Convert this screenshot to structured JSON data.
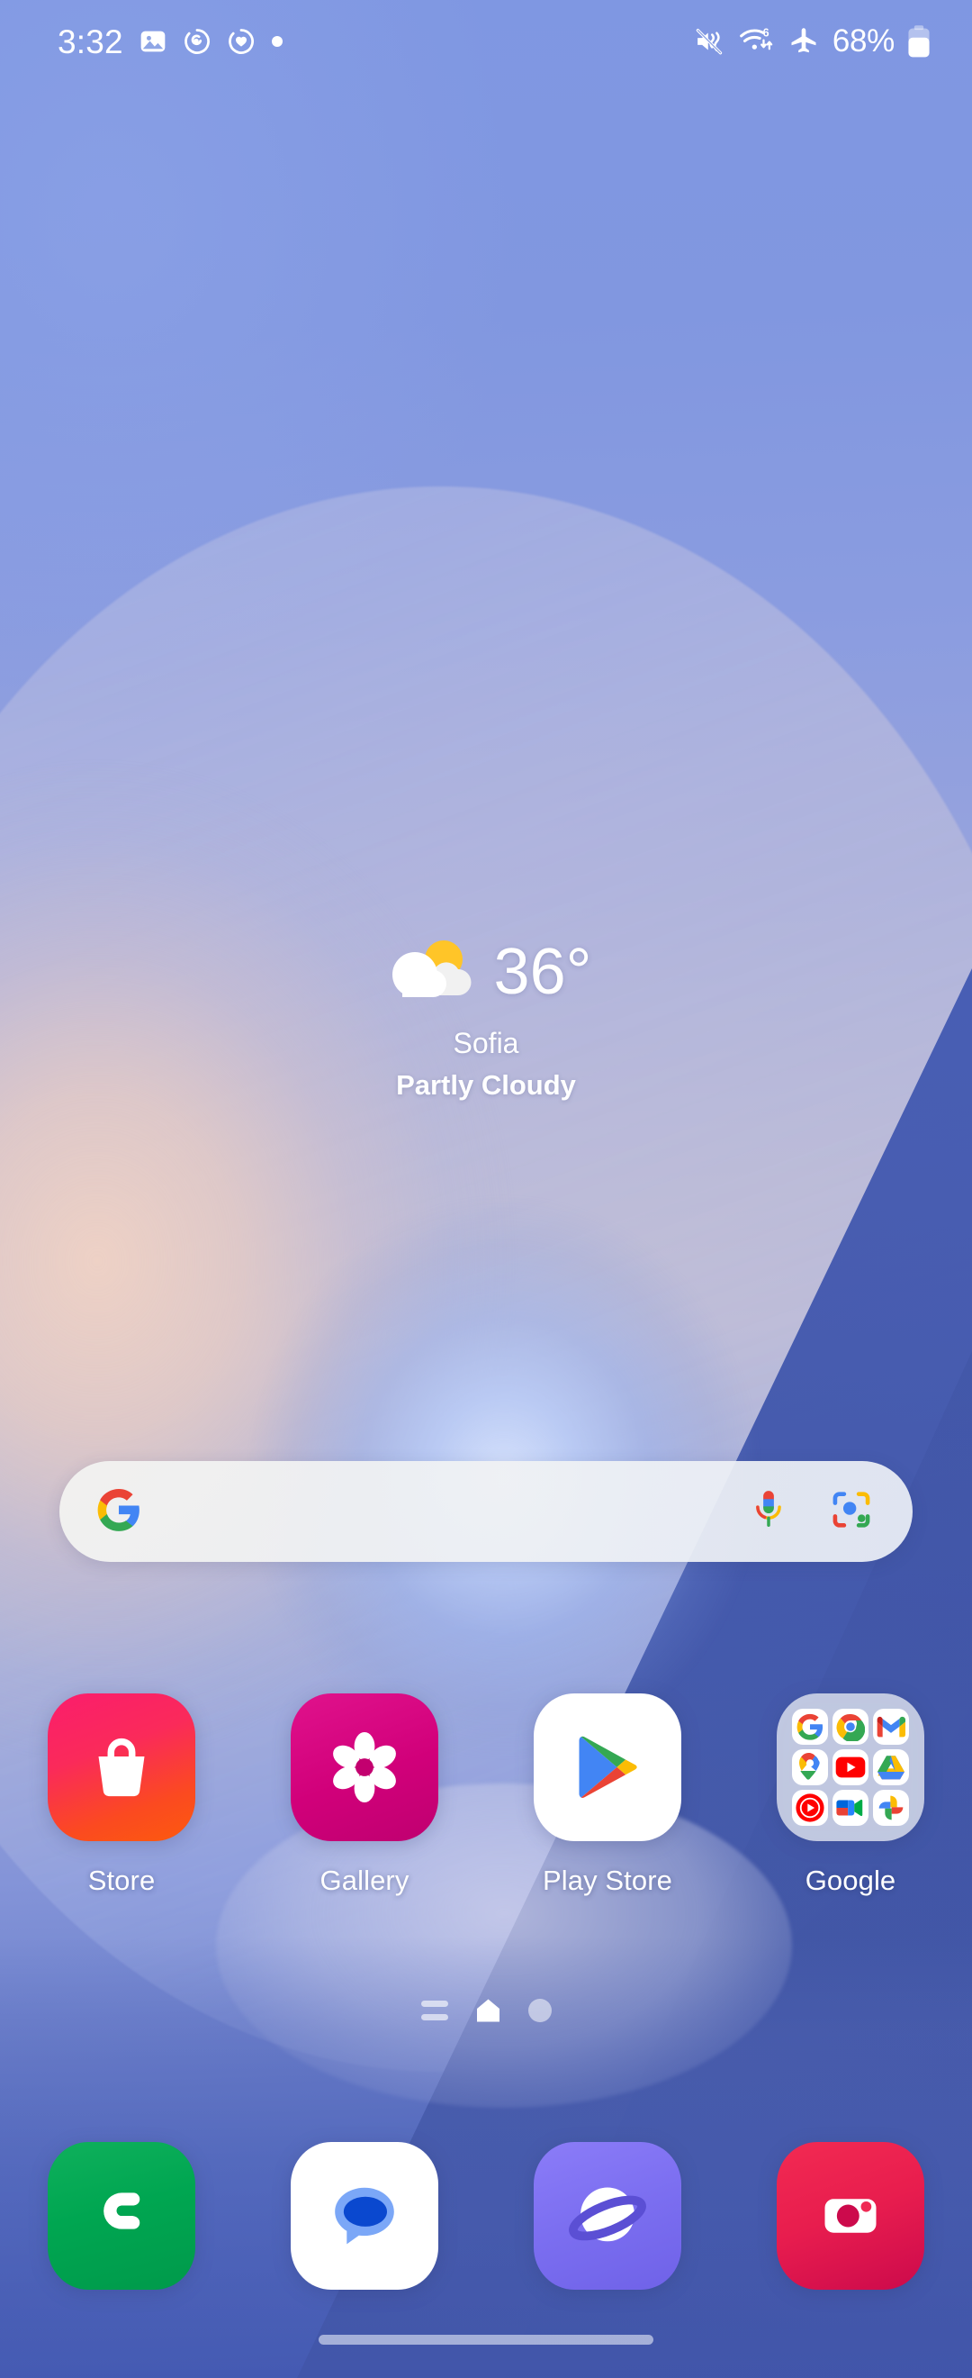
{
  "status_bar": {
    "time": "3:32",
    "left_icons": [
      "image-icon",
      "sync-circle-icon",
      "heart-circle-icon",
      "dot-icon"
    ],
    "right_icons": [
      "mute-vibrate-icon",
      "wifi-6-data-icon",
      "airplane-mode-icon"
    ],
    "battery_percent": "68%",
    "battery_level": 68
  },
  "weather": {
    "icon": "partly-cloudy-icon",
    "temperature": "36°",
    "city": "Sofia",
    "condition": "Partly Cloudy"
  },
  "search": {
    "logo": "google-g-icon",
    "value": "",
    "placeholder": "",
    "mic_icon": "microphone-icon",
    "lens_icon": "google-lens-icon"
  },
  "app_grid": [
    {
      "label": "Store",
      "icon": "galaxy-store-icon"
    },
    {
      "label": "Gallery",
      "icon": "gallery-flower-icon"
    },
    {
      "label": "Play Store",
      "icon": "play-store-icon"
    },
    {
      "label": "Google",
      "icon": "google-folder-icon",
      "folder_apps": [
        "google-icon",
        "chrome-icon",
        "gmail-icon",
        "maps-icon",
        "youtube-icon",
        "drive-icon",
        "youtube-music-icon",
        "meet-icon",
        "photos-icon"
      ]
    }
  ],
  "page_indicator": {
    "items": [
      "app-list-lines-icon",
      "home-house-icon",
      "page-dot-icon"
    ],
    "active_index": 1
  },
  "dock": [
    {
      "label": "Phone",
      "icon": "phone-icon"
    },
    {
      "label": "Messages",
      "icon": "messages-icon"
    },
    {
      "label": "Internet",
      "icon": "samsung-internet-icon"
    },
    {
      "label": "Camera",
      "icon": "camera-icon"
    }
  ],
  "navigation": {
    "home_indicator": "home-indicator-bar"
  },
  "colors": {
    "store_start": "#f72b6d",
    "store_end": "#fb4a12",
    "gallery": "#d1007e",
    "phone": "#00a651",
    "camera_start": "#ee2a4f",
    "camera_end": "#d10a4e",
    "internet": "#7b6ef0",
    "google_blue": "#4285f4",
    "google_red": "#ea4335",
    "google_yellow": "#fbbc05",
    "google_green": "#34a853",
    "weather_sun": "#ffc528",
    "folder_bg": "#d3d8e9"
  }
}
